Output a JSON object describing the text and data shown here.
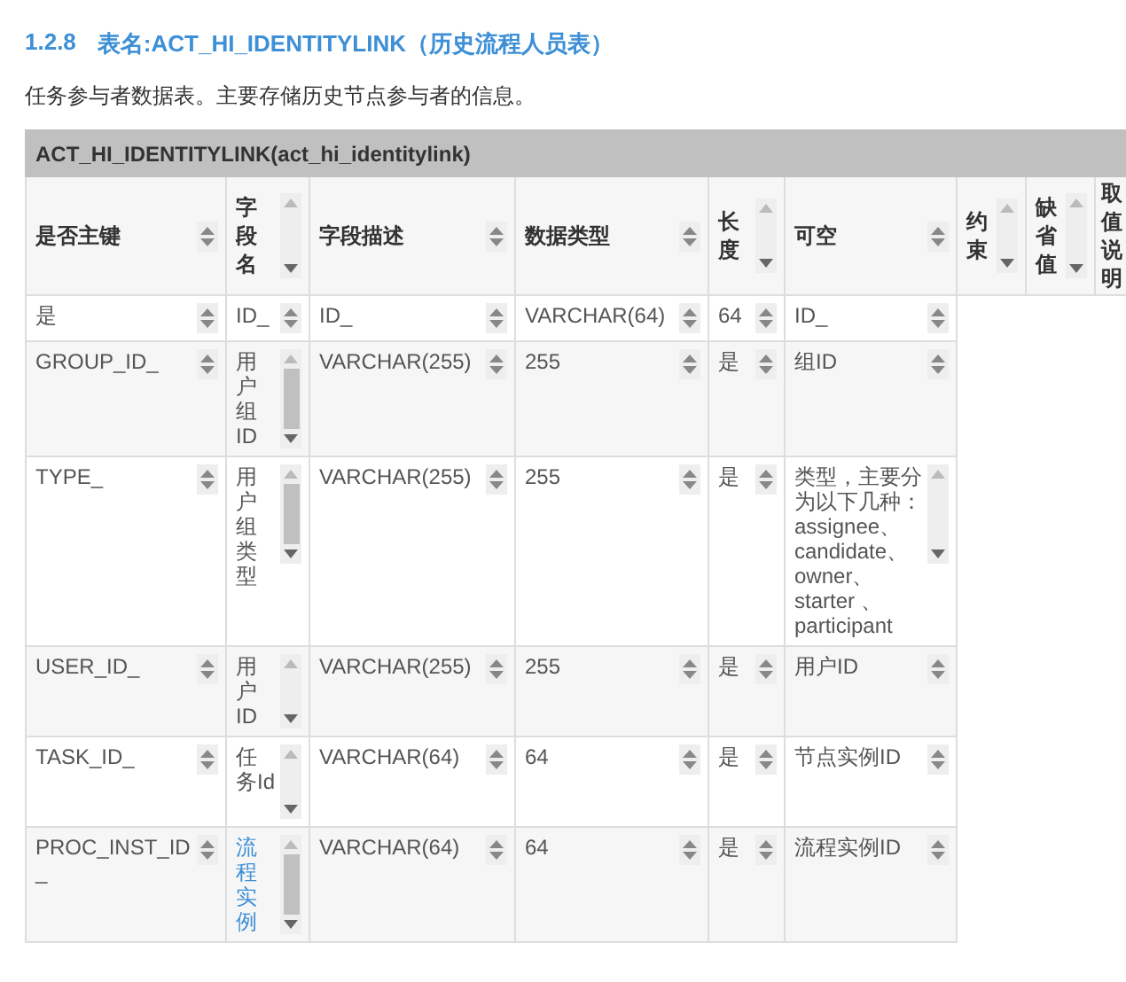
{
  "heading": {
    "number": "1.2.8",
    "title": "表名:ACT_HI_IDENTITYLINK（历史流程人员表）"
  },
  "description": "任务参与者数据表。主要存储历史节点参与者的信息。",
  "table": {
    "caption": "ACT_HI_IDENTITYLINK(act_hi_identitylink)",
    "columns": [
      {
        "label": "是否主键",
        "kind": "sort"
      },
      {
        "label": "字段名",
        "kind": "scroll"
      },
      {
        "label": "字段描述",
        "kind": "sort"
      },
      {
        "label": "数据类型",
        "kind": "sort"
      },
      {
        "label": "长度",
        "kind": "scroll"
      },
      {
        "label": "可空",
        "kind": "sort"
      },
      {
        "label": "约束",
        "kind": "scroll"
      },
      {
        "label": "缺省值",
        "kind": "scroll"
      },
      {
        "label": "取值说明",
        "kind": "none"
      }
    ],
    "rows": [
      {
        "cells": [
          {
            "text": "是",
            "kind": "sort",
            "link": false
          },
          {
            "text": "ID_",
            "kind": "sort",
            "link": false
          },
          {
            "text": "ID_",
            "kind": "sort",
            "link": false
          },
          {
            "text": "VARCHAR(64)",
            "kind": "sort",
            "link": false
          },
          {
            "text": "64",
            "kind": "sort",
            "link": false
          },
          {
            "text": "ID_",
            "kind": "sort",
            "link": false
          }
        ]
      },
      {
        "cells": [
          {
            "text": "GROUP_ID_",
            "kind": "sort",
            "link": false
          },
          {
            "text": "用户组ID",
            "kind": "scroll_thumb",
            "link": false
          },
          {
            "text": "VARCHAR(255)",
            "kind": "sort",
            "link": false
          },
          {
            "text": "255",
            "kind": "sort",
            "link": false
          },
          {
            "text": "是",
            "kind": "sort",
            "link": false
          },
          {
            "text": "组ID",
            "kind": "sort",
            "link": false
          }
        ]
      },
      {
        "cells": [
          {
            "text": "TYPE_",
            "kind": "sort",
            "link": false
          },
          {
            "text": "用户组类型",
            "kind": "scroll_thumb",
            "link": false
          },
          {
            "text": "VARCHAR(255)",
            "kind": "sort",
            "link": false
          },
          {
            "text": "255",
            "kind": "sort",
            "link": false
          },
          {
            "text": "是",
            "kind": "sort",
            "link": false
          },
          {
            "text": "类型，主要分为以下几种：assignee、candidate、owner、starter 、participant",
            "kind": "scroll",
            "link": false
          }
        ]
      },
      {
        "cells": [
          {
            "text": "USER_ID_",
            "kind": "sort",
            "link": false
          },
          {
            "text": "用户ID",
            "kind": "scroll",
            "link": false
          },
          {
            "text": "VARCHAR(255)",
            "kind": "sort",
            "link": false
          },
          {
            "text": "255",
            "kind": "sort",
            "link": false
          },
          {
            "text": "是",
            "kind": "sort",
            "link": false
          },
          {
            "text": "用户ID",
            "kind": "sort",
            "link": false
          }
        ]
      },
      {
        "cells": [
          {
            "text": "TASK_ID_",
            "kind": "sort",
            "link": false
          },
          {
            "text": "任务Id",
            "kind": "scroll",
            "link": false
          },
          {
            "text": "VARCHAR(64)",
            "kind": "sort",
            "link": false
          },
          {
            "text": "64",
            "kind": "sort",
            "link": false
          },
          {
            "text": "是",
            "kind": "sort",
            "link": false
          },
          {
            "text": "节点实例ID",
            "kind": "sort",
            "link": false
          }
        ]
      },
      {
        "cells": [
          {
            "text": "PROC_INST_ID_",
            "kind": "sort",
            "link": false
          },
          {
            "text": "流程实例",
            "kind": "scroll_thumb",
            "link": true
          },
          {
            "text": "VARCHAR(64)",
            "kind": "sort",
            "link": false
          },
          {
            "text": "64",
            "kind": "sort",
            "link": false
          },
          {
            "text": "是",
            "kind": "sort",
            "link": false
          },
          {
            "text": "流程实例ID",
            "kind": "sort",
            "link": false
          }
        ]
      }
    ]
  }
}
